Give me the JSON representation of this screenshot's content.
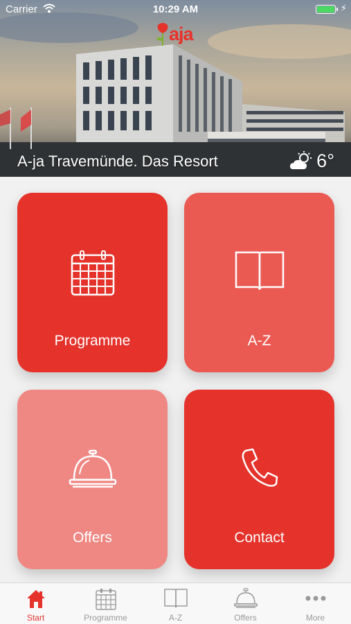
{
  "status_bar": {
    "carrier": "Carrier",
    "time": "10:29 AM"
  },
  "header": {
    "logo_text": "aja",
    "hotel_name": "A-ja Travemünde. Das Resort",
    "weather": {
      "icon": "partly-sunny-icon",
      "temperature": "6°"
    }
  },
  "tiles": [
    {
      "label": "Programme",
      "icon": "calendar-icon",
      "color": "#e5322b"
    },
    {
      "label": "A-Z",
      "icon": "book-icon",
      "color": "#ea5a53"
    },
    {
      "label": "Offers",
      "icon": "service-bell-icon",
      "color": "#ef8783"
    },
    {
      "label": "Contact",
      "icon": "phone-icon",
      "color": "#e5322b"
    }
  ],
  "tabbar": {
    "active_color": "#e5322b",
    "items": [
      {
        "label": "Start",
        "icon": "home-icon",
        "active": true
      },
      {
        "label": "Programme",
        "icon": "calendar-icon",
        "active": false
      },
      {
        "label": "A-Z",
        "icon": "book-icon",
        "active": false
      },
      {
        "label": "Offers",
        "icon": "service-bell-icon",
        "active": false
      },
      {
        "label": "More",
        "icon": "more-dots-icon",
        "active": false
      }
    ]
  }
}
